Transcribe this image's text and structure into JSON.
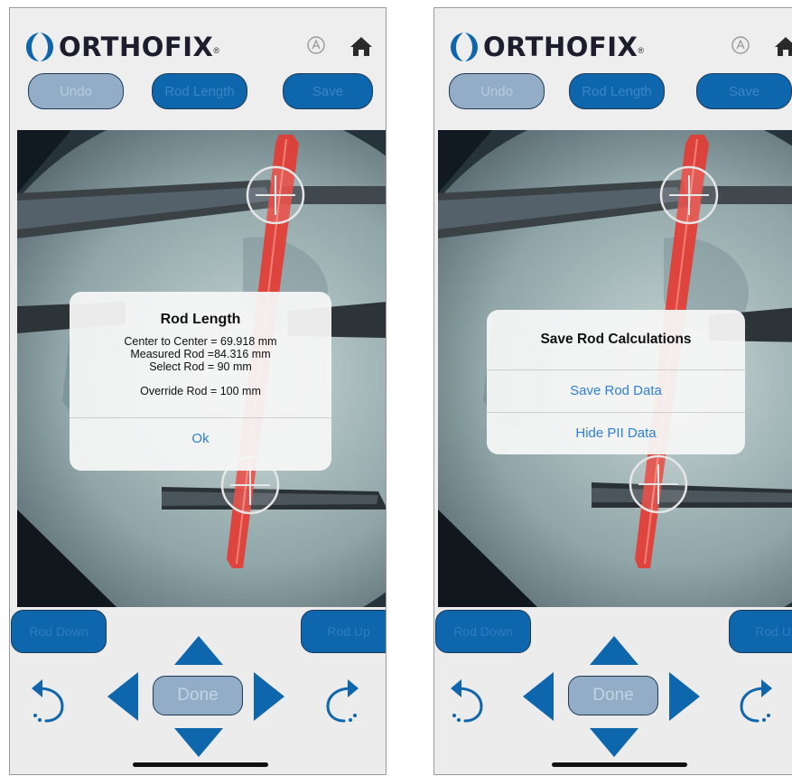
{
  "brand": {
    "name": "ORTHOFIX",
    "registered_mark": "®"
  },
  "colors": {
    "brand_blue": "#0e66ad",
    "disabled_blue": "#93adc6",
    "rod_red": "#e63a32",
    "link_blue": "#2f7fd6"
  },
  "icons": {
    "auto": "circle-a-icon",
    "home": "home-icon"
  },
  "toolbar": {
    "undo_label": "Undo",
    "rod_length_label": "Rod Length",
    "save_label": "Save"
  },
  "controls": {
    "rod_down_label": "Rod Down",
    "rod_up_label": "Rod Up",
    "done_label": "Done"
  },
  "rod_length_dialog": {
    "title": "Rod Length",
    "center_to_center": "Center to Center = 69.918 mm",
    "measured_rod": "Measured Rod =84.316 mm",
    "select_rod": "Select Rod = 90 mm",
    "override_rod": "Override Rod = 100 mm",
    "ok_label": "Ok"
  },
  "save_dialog": {
    "title": "Save Rod Calculations",
    "save_rod_data_label": "Save Rod Data",
    "hide_pii_label": "Hide PII Data"
  }
}
